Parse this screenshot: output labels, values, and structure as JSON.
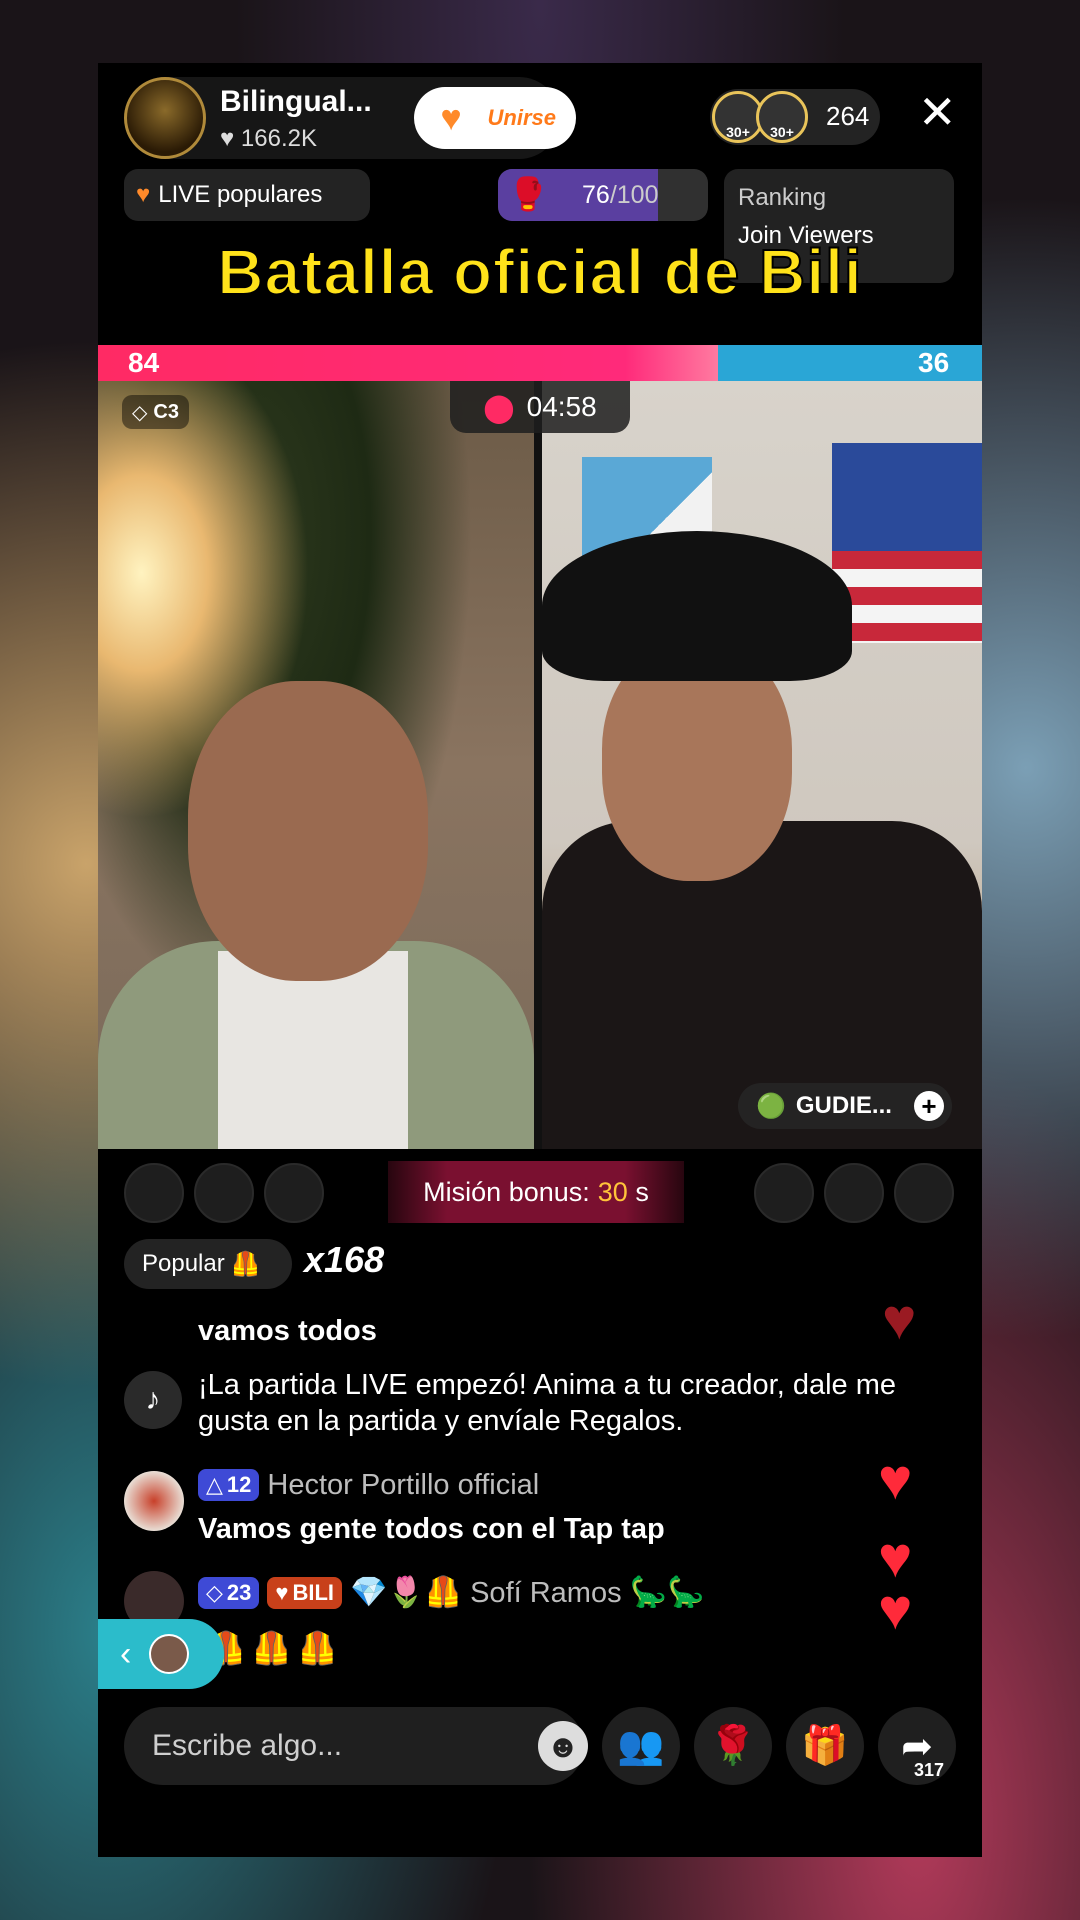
{
  "header": {
    "host_name": "Bilingual...",
    "host_likes": "166.2K",
    "join_label": "Unirse",
    "viewer_avatars": [
      "30+",
      "30+"
    ],
    "viewer_count": "264",
    "close_glyph": "✕"
  },
  "badges": {
    "live_popular": "LIVE populares",
    "progress_value": "76",
    "progress_total": "/100",
    "progress_fraction": 0.76,
    "ranking_title": "Ranking",
    "ranking_sub": "Join Viewers"
  },
  "banner_title": "Batalla oficial de Bili",
  "battle": {
    "score_left": "84",
    "score_right": "36",
    "timer": "04:58",
    "left_badge": "C3",
    "right_name": "GUDIE..."
  },
  "mission": {
    "label": "Misión bonus:",
    "value": "30",
    "unit": "s"
  },
  "popular": {
    "label": "Popular",
    "multiplier": "x168"
  },
  "chat": [
    {
      "text": "vamos todos"
    },
    {
      "text": "¡La partida LIVE empezó! Anima a tu creador, dale me gusta en la partida y envíale Regalos."
    },
    {
      "level": "12",
      "user": "Hector Portillo official",
      "text": "Vamos gente todos con el Tap tap"
    },
    {
      "level": "23",
      "fan_badge": "BILI",
      "user": "Sofí Ramos",
      "emojis_before": "💎🌷🦺",
      "emojis_after": "🦕🦕",
      "line2": "🦺🦺🦺"
    }
  ],
  "input_placeholder": "Escribe algo...",
  "actions": {
    "share_count": "317"
  },
  "icons": {
    "heart": "heart-icon",
    "tiktok": "tiktok-icon",
    "gift": "gift-icon",
    "rose": "rose-icon",
    "share": "share-icon",
    "multiguest": "multiguest-icon"
  },
  "colors": {
    "accent_pink": "#ff2a64",
    "accent_blue": "#2aa6d6",
    "title_yellow": "#ffe21a",
    "level_blue": "#3e4ad6"
  }
}
